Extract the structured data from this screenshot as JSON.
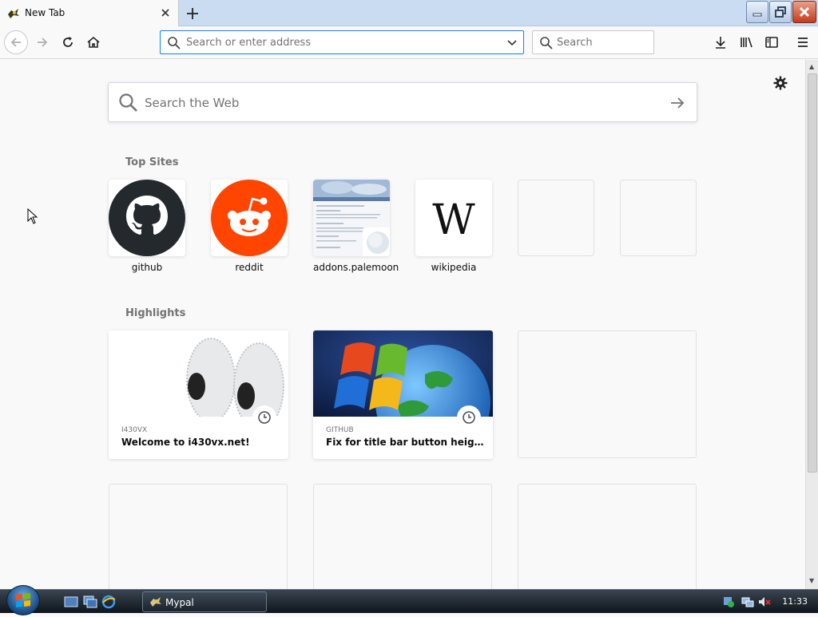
{
  "tab": {
    "title": "New Tab"
  },
  "navbar": {
    "url_placeholder": "Search or enter address",
    "search_placeholder": "Search"
  },
  "newtab": {
    "search_placeholder": "Search the Web",
    "top_sites_title": "Top Sites",
    "top_sites": [
      {
        "label": "github",
        "icon": "github-icon"
      },
      {
        "label": "reddit",
        "icon": "reddit-icon"
      },
      {
        "label": "addons.palemoon",
        "icon": "screenshot-thumbnail"
      },
      {
        "label": "wikipedia",
        "icon": "wikipedia-icon"
      },
      {
        "label": ""
      },
      {
        "label": ""
      }
    ],
    "highlights_title": "Highlights",
    "highlights": [
      {
        "source": "I430VX",
        "title": "Welcome to i430vx.net!"
      },
      {
        "source": "GITHUB",
        "title": "Fix for title bar button height to ..."
      }
    ]
  },
  "taskbar": {
    "items": [
      {
        "label": "Mypal"
      }
    ],
    "clock": "11:33"
  },
  "colors": {
    "accent": "#0a84ff",
    "reddit": "#ff4500",
    "github": "#24292e"
  }
}
